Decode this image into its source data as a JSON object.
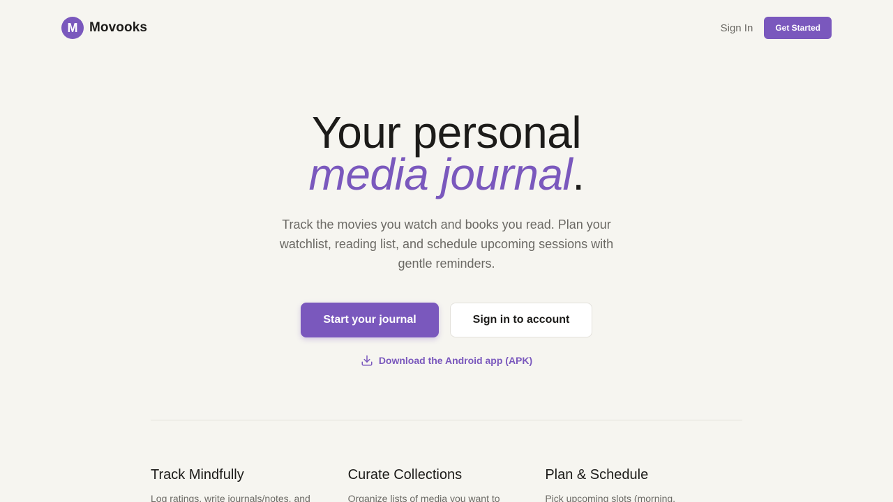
{
  "brand": {
    "logo_letter": "M",
    "name": "Movooks",
    "accent_color": "#7a58bd"
  },
  "nav": {
    "sign_in": "Sign In",
    "get_started": "Get Started"
  },
  "hero": {
    "line1": "Your personal",
    "line2_accent": "media journal",
    "line2_period": ".",
    "subtitle": "Track the movies you watch and books you read. Plan your watchlist, reading list, and schedule upcoming sessions with gentle reminders.",
    "primary_cta": "Start your journal",
    "secondary_cta": "Sign in to account",
    "download_icon": "download-icon",
    "download_link": "Download the Android app (APK)"
  },
  "features": [
    {
      "title": "Track Mindfully",
      "description": "Log ratings, write journals/notes, and"
    },
    {
      "title": "Curate Collections",
      "description": "Organize lists of media you want to"
    },
    {
      "title": "Plan & Schedule",
      "description": "Pick upcoming slots (morning,"
    }
  ]
}
